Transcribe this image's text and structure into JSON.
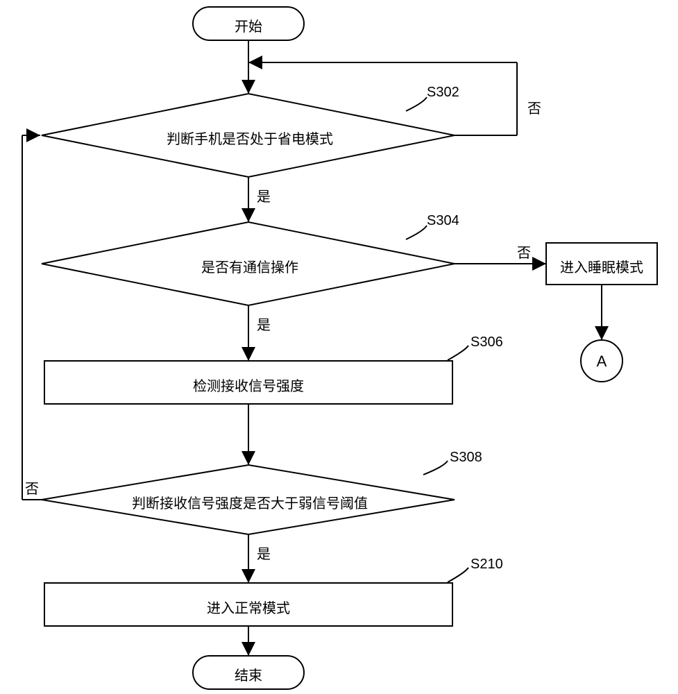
{
  "flowchart": {
    "start": "开始",
    "end": "结束",
    "decisions": {
      "s302": {
        "text": "判断手机是否处于省电模式",
        "label": "S302"
      },
      "s304": {
        "text": "是否有通信操作",
        "label": "S304"
      },
      "s308": {
        "text": "判断接收信号强度是否大于弱信号阈值",
        "label": "S308"
      }
    },
    "processes": {
      "s306": {
        "text": "检测接收信号强度",
        "label": "S306"
      },
      "s210": {
        "text": "进入正常模式",
        "label": "S210"
      },
      "sleep": "进入睡眠模式"
    },
    "connector": "A",
    "branch_labels": {
      "yes": "是",
      "no": "否"
    }
  }
}
